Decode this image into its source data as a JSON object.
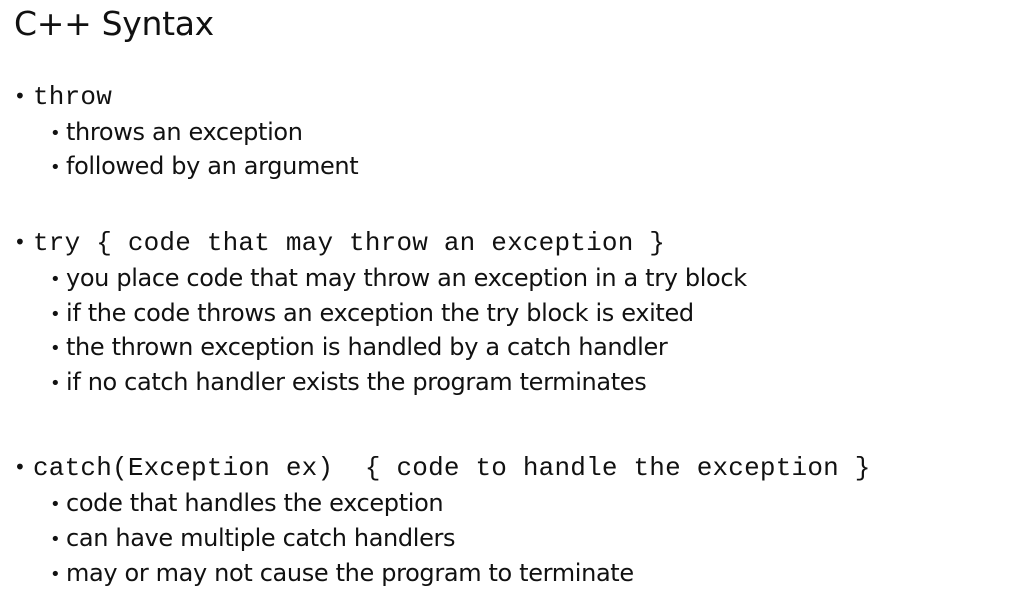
{
  "title": "C++ Syntax",
  "bullet": "•",
  "sections": [
    {
      "code": "throw",
      "points": [
        "throws an exception",
        "followed by an argument"
      ]
    },
    {
      "code": "try { code that may throw an exception }",
      "points": [
        "you place code that may throw an exception in a try block",
        "if the code throws an exception the try block is exited",
        "the thrown exception is handled by a catch handler",
        "if no catch handler exists the program terminates"
      ]
    },
    {
      "code": "catch(Exception ex)  { code to handle the exception }",
      "points": [
        "code that handles the exception",
        "can have multiple catch handlers",
        "may or may not cause the program to terminate"
      ]
    }
  ]
}
